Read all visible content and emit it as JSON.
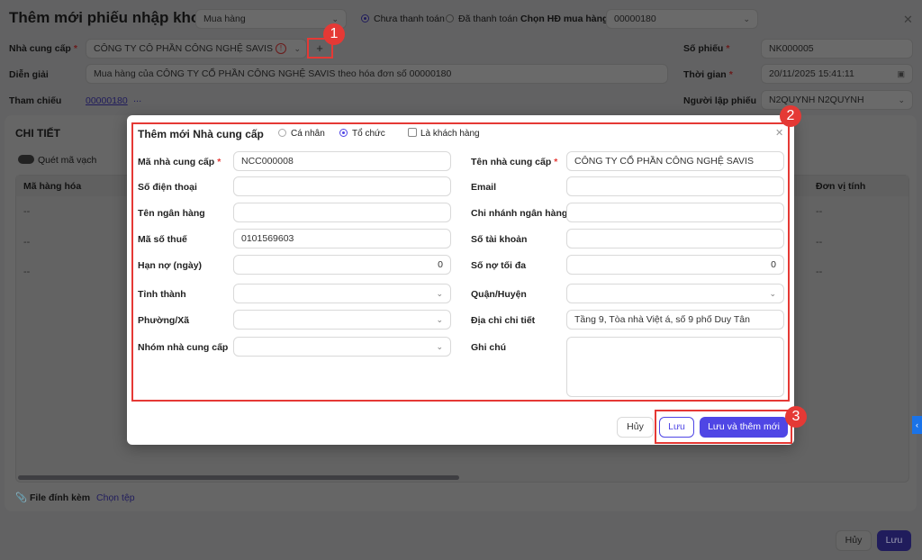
{
  "page": {
    "title": "Thêm mới phiếu nhập kho",
    "type_select": "Mua hàng",
    "payment_options": [
      "Chưa thanh toán",
      "Đã thanh toán"
    ],
    "payment_selected": 0,
    "purchase_invoice_label": "Chọn HĐ mua hàng",
    "purchase_invoice_value": "00000180",
    "supplier_label": "Nhà cung cấp",
    "supplier_value": "CÔNG TY CÔ PHẦN CÔNG NGHỆ SAVIS",
    "add_supplier_button": "+",
    "description_label": "Diễn giải",
    "description_value": "Mua hàng của CÔNG TY CỔ PHẦN CÔNG NGHỆ SAVIS theo hóa đơn số 00000180",
    "reference_label": "Tham chiếu",
    "reference_link": "00000180",
    "reference_more": "...",
    "voucher_no_label": "Số phiếu",
    "voucher_no_value": "NK000005",
    "time_label": "Thời gian",
    "time_value": "20/11/2025 15:41:11",
    "creator_label": "Người lập phiếu",
    "creator_value": "N2QUYNH N2QUYNH",
    "detail_title": "CHI TIẾT",
    "barcode_toggle": "Quét mã vạch",
    "table_headers": [
      "Mã hàng hóa",
      "Đơn vị tính"
    ],
    "table_rows": [
      "--",
      "--",
      "--"
    ],
    "attachment_label": "File đính kèm",
    "choose_file": "Chọn tệp",
    "cancel": "Hủy",
    "save": "Lưu"
  },
  "modal": {
    "title": "Thêm mới Nhà cung cấp",
    "type_options": [
      "Cá nhân",
      "Tổ chức"
    ],
    "type_selected": 1,
    "is_customer_label": "Là khách hàng",
    "left": [
      {
        "label": "Mã nhà cung cấp",
        "value": "NCC000008",
        "required": true
      },
      {
        "label": "Số điện thoại",
        "value": ""
      },
      {
        "label": "Tên ngân hàng",
        "value": ""
      },
      {
        "label": "Mã số thuế",
        "value": "0101569603"
      },
      {
        "label": "Hạn nợ (ngày)",
        "value": "0"
      },
      {
        "label": "Tỉnh thành",
        "value": ""
      },
      {
        "label": "Phường/Xã",
        "value": ""
      },
      {
        "label": "Nhóm nhà cung cấp",
        "value": ""
      }
    ],
    "right": [
      {
        "label": "Tên nhà cung cấp",
        "value": "CÔNG TY CỔ PHẦN CÔNG NGHỆ SAVIS",
        "required": true
      },
      {
        "label": "Email",
        "value": ""
      },
      {
        "label": "Chi nhánh ngân hàng",
        "value": ""
      },
      {
        "label": "Số tài khoản",
        "value": ""
      },
      {
        "label": "Số nợ tối đa",
        "value": "0"
      },
      {
        "label": "Quận/Huyện",
        "value": ""
      },
      {
        "label": "Địa chỉ chi tiết",
        "value": "Tầng 9, Tòa nhà Việt á, số 9 phố Duy Tân"
      },
      {
        "label": "Ghi chú",
        "value": ""
      }
    ],
    "cancel": "Hủy",
    "save": "Lưu",
    "save_and_new": "Lưu và thêm mới"
  },
  "annotations": [
    "1",
    "2",
    "3"
  ],
  "colors": {
    "primary": "#4f46e5",
    "annotation": "#e53935"
  }
}
